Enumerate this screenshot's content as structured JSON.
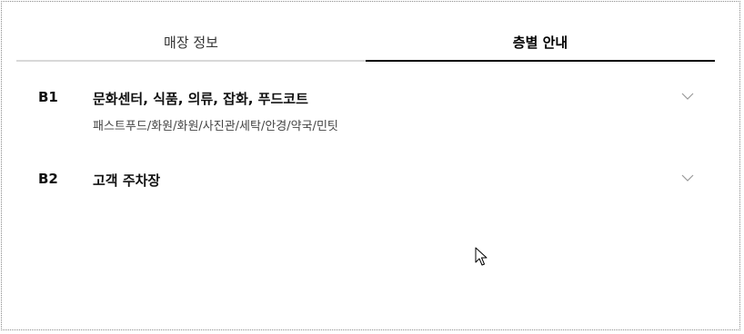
{
  "tabs": [
    {
      "label": "매장 정보",
      "active": false
    },
    {
      "label": "층별 안내",
      "active": true
    }
  ],
  "floors": [
    {
      "code": "B1",
      "title": "문화센터, 식품, 의류, 잡화, 푸드코트",
      "subtitle": "패스트푸드/화원/화원/사진관/세탁/안경/약국/민팃",
      "expand_icon": "chevron-down-icon"
    },
    {
      "code": "B2",
      "title": "고객 주차장",
      "subtitle": "",
      "expand_icon": "chevron-down-icon"
    }
  ],
  "colors": {
    "active_underline": "#000000",
    "inactive_underline": "#d8d8d8",
    "chevron": "#9a9a9a"
  }
}
